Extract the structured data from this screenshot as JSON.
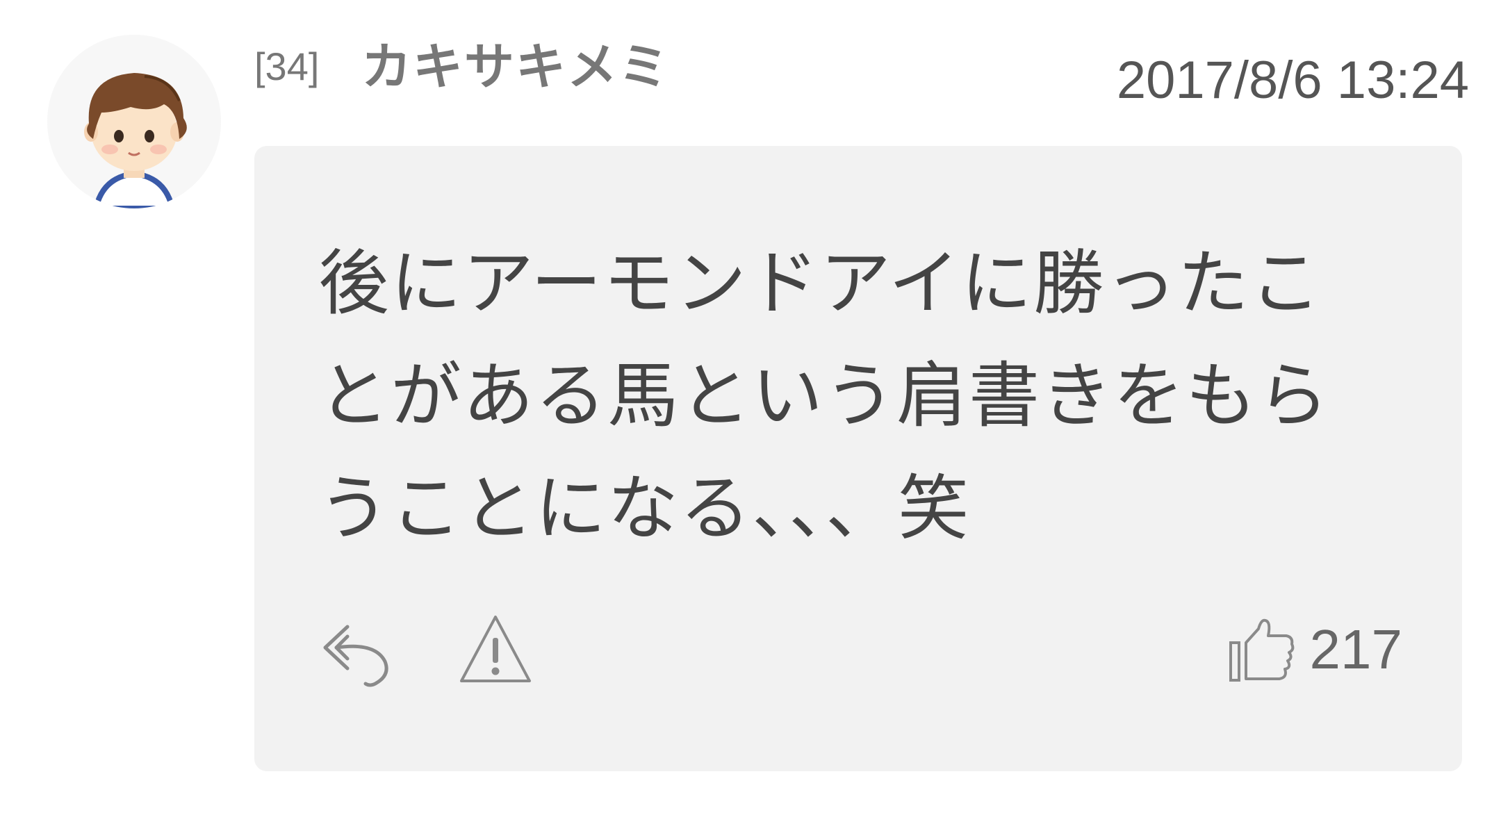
{
  "comment": {
    "number": "[34]",
    "author": "カキサキメミ",
    "timestamp": "2017/8/6 13:24",
    "body": "後にアーモンドアイに勝ったことがある馬という肩書きをもらうことになる、、、笑",
    "likes": "217"
  },
  "icons": {
    "avatar": "avatar-illustration",
    "reply": "reply-icon",
    "report": "warning-icon",
    "like": "thumbs-up-icon"
  },
  "colors": {
    "bubble": "#f2f2f2",
    "text": "#444444",
    "muted": "#777777",
    "icon": "#8a8a8a"
  }
}
